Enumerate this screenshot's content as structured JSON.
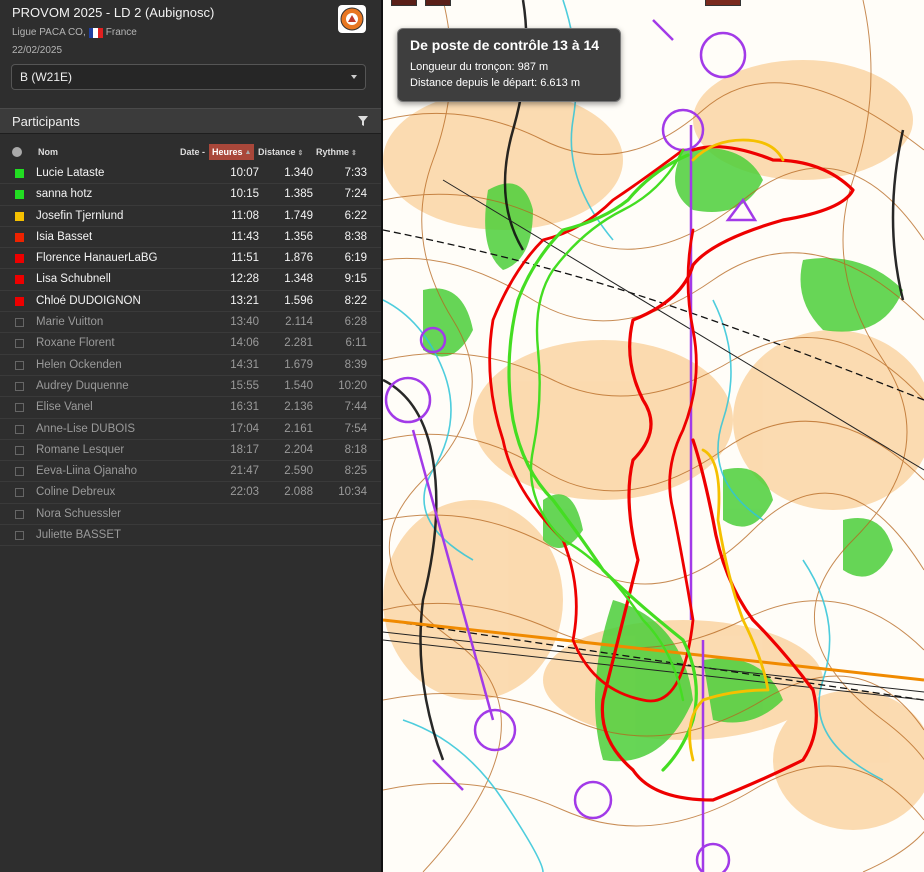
{
  "event": {
    "title": "PROVOM 2025 - LD 2 (Aubignosc)",
    "organizer": "Ligue PACA CO,",
    "country": "France",
    "date": "22/02/2025",
    "logo_icon": "orienteering-logo-icon"
  },
  "category": {
    "selected": "B (W21E)"
  },
  "participants": {
    "title": "Participants",
    "filter_icon": "filter-icon",
    "headers": {
      "name": "Nom",
      "date": "Date -",
      "time": "Heures",
      "distance": "Distance",
      "pace": "Rythme"
    },
    "rows": [
      {
        "name": "Lucie Lataste",
        "time": "10:07",
        "distance": "1.340",
        "pace": "7:33",
        "color": "#22dd22",
        "active": true
      },
      {
        "name": "sanna hotz",
        "time": "10:15",
        "distance": "1.385",
        "pace": "7:24",
        "color": "#22dd22",
        "active": true
      },
      {
        "name": "Josefin Tjernlund",
        "time": "11:08",
        "distance": "1.749",
        "pace": "6:22",
        "color": "#f5c000",
        "active": true
      },
      {
        "name": "Isia Basset",
        "time": "11:43",
        "distance": "1.356",
        "pace": "8:38",
        "color": "#ee2200",
        "active": true
      },
      {
        "name": "Florence HanauerLaBG",
        "time": "11:51",
        "distance": "1.876",
        "pace": "6:19",
        "color": "#ee0000",
        "active": true
      },
      {
        "name": "Lisa Schubnell",
        "time": "12:28",
        "distance": "1.348",
        "pace": "9:15",
        "color": "#ee0000",
        "active": true
      },
      {
        "name": "Chloé DUDOIGNON",
        "time": "13:21",
        "distance": "1.596",
        "pace": "8:22",
        "color": "#ee0000",
        "active": true
      },
      {
        "name": "Marie Vuitton",
        "time": "13:40",
        "distance": "2.114",
        "pace": "6:28",
        "active": false
      },
      {
        "name": "Roxane Florent",
        "time": "14:06",
        "distance": "2.281",
        "pace": "6:11",
        "active": false
      },
      {
        "name": "Helen Ockenden",
        "time": "14:31",
        "distance": "1.679",
        "pace": "8:39",
        "active": false
      },
      {
        "name": "Audrey Duquenne",
        "time": "15:55",
        "distance": "1.540",
        "pace": "10:20",
        "active": false
      },
      {
        "name": "Elise Vanel",
        "time": "16:31",
        "distance": "2.136",
        "pace": "7:44",
        "active": false
      },
      {
        "name": "Anne-Lise DUBOIS",
        "time": "17:04",
        "distance": "2.161",
        "pace": "7:54",
        "active": false
      },
      {
        "name": "Romane Lesquer",
        "time": "18:17",
        "distance": "2.204",
        "pace": "8:18",
        "active": false
      },
      {
        "name": "Eeva-Liina Ojanaho",
        "time": "21:47",
        "distance": "2.590",
        "pace": "8:25",
        "active": false
      },
      {
        "name": "Coline Debreux",
        "time": "22:03",
        "distance": "2.088",
        "pace": "10:34",
        "active": false
      },
      {
        "name": "Nora Schuessler",
        "time": "",
        "distance": "",
        "pace": "",
        "active": false
      },
      {
        "name": "Juliette BASSET",
        "time": "",
        "distance": "",
        "pace": "",
        "active": false
      }
    ]
  },
  "tooltip": {
    "title": "De poste de contrôle 13 à 14",
    "line1": "Longueur du tronçon: 987 m",
    "line2": "Distance depuis le départ: 6.613 m"
  }
}
